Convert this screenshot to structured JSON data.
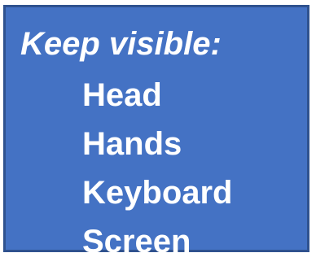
{
  "panel": {
    "heading": "Keep visible:",
    "items": [
      "Head",
      "Hands",
      "Keyboard",
      "Screen"
    ],
    "background_color": "#4472c4",
    "text_color": "#ffffff"
  }
}
